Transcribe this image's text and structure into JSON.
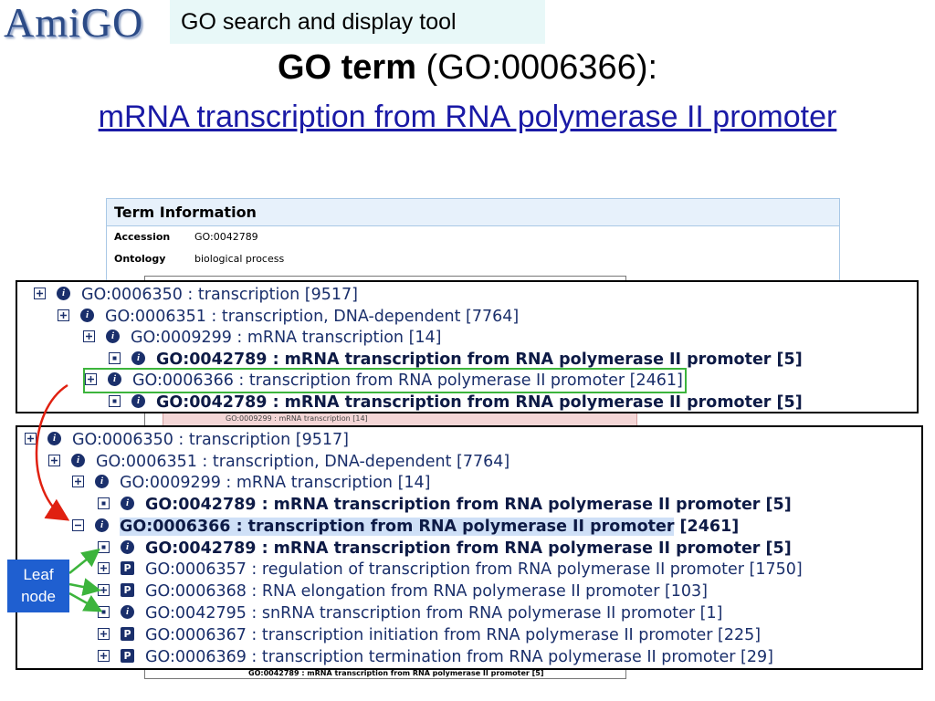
{
  "header": {
    "logo_text": "AmiGO",
    "subtitle": "GO search and display tool",
    "title_bold": "GO term",
    "title_rest": " (GO:0006366):",
    "term_name": "mRNA transcription from RNA polymerase II promoter"
  },
  "term_panel": {
    "heading": "Term Information",
    "rows": [
      {
        "key": "Accession",
        "value": "GO:0042789"
      },
      {
        "key": "Ontology",
        "value": "biological process"
      }
    ]
  },
  "background_strips": {
    "pink": "GO:0009299 : mRNA transcription [14]",
    "bottom": "GO:0042789 : mRNA transcription from RNA polymerase II promoter [5]"
  },
  "top_tree": [
    {
      "ctl": "plus",
      "icon": "i",
      "text": "GO:0006350 : transcription  [9517]",
      "bold": false
    },
    {
      "ctl": "plus",
      "icon": "i",
      "text": "GO:0006351 : transcription, DNA-dependent [7764]",
      "bold": false
    },
    {
      "ctl": "plus",
      "icon": "i",
      "text": "GO:0009299 : mRNA transcription [14]",
      "bold": false
    },
    {
      "ctl": "dot",
      "icon": "i",
      "text": "GO:0042789 : mRNA transcription from RNA polymerase II promoter [5]",
      "bold": true
    },
    {
      "ctl": "plus",
      "icon": "i",
      "text": "GO:0006366 : transcription from RNA polymerase II promoter [2461]",
      "bold": false
    },
    {
      "ctl": "dot",
      "icon": "i",
      "text": "GO:0042789 : mRNA transcription from RNA polymerase II promoter [5]",
      "bold": true
    }
  ],
  "bottom_tree": [
    {
      "ctl": "plus",
      "icon": "i",
      "text": "GO:0006350 : transcription  [9517]",
      "bold": false
    },
    {
      "ctl": "plus",
      "icon": "i",
      "text": "GO:0006351 : transcription, DNA-dependent [7764]",
      "bold": false
    },
    {
      "ctl": "plus",
      "icon": "i",
      "text": "GO:0009299 : mRNA transcription [14]",
      "bold": false
    },
    {
      "ctl": "dot",
      "icon": "i",
      "text": "GO:0042789 : mRNA transcription from RNA polymerase II promoter [5]",
      "bold": true
    },
    {
      "ctl": "minus",
      "icon": "i",
      "text": "GO:0006366 : transcription from RNA polymerase II promoter",
      "suffix": " [2461]",
      "bold": true
    },
    {
      "ctl": "dot",
      "icon": "i",
      "text": "GO:0042789 : mRNA transcription from RNA polymerase II promoter [5]",
      "bold": true
    },
    {
      "ctl": "plus",
      "icon": "P",
      "text": "GO:0006357 : regulation of transcription from RNA polymerase II promoter [1750]",
      "bold": false
    },
    {
      "ctl": "plus",
      "icon": "P",
      "text": "GO:0006368 : RNA elongation from RNA polymerase II promoter [103]",
      "bold": false
    },
    {
      "ctl": "dot",
      "icon": "i",
      "text": "GO:0042795 : snRNA transcription from RNA polymerase II promoter [1]",
      "bold": false
    },
    {
      "ctl": "plus",
      "icon": "P",
      "text": "GO:0006367 : transcription initiation from RNA polymerase II promoter [225]",
      "bold": false
    },
    {
      "ctl": "plus",
      "icon": "P",
      "text": "GO:0006369 : transcription termination from RNA polymerase II promoter [29]",
      "bold": false
    }
  ],
  "annotation": {
    "leaf_label_line1": "Leaf",
    "leaf_label_line2": "node",
    "arrow_color": "#e02010",
    "leaf_arrow_color": "#3cb43c",
    "highlight_color": "#3cb43c",
    "selected_bg": "#cfe0f7"
  }
}
